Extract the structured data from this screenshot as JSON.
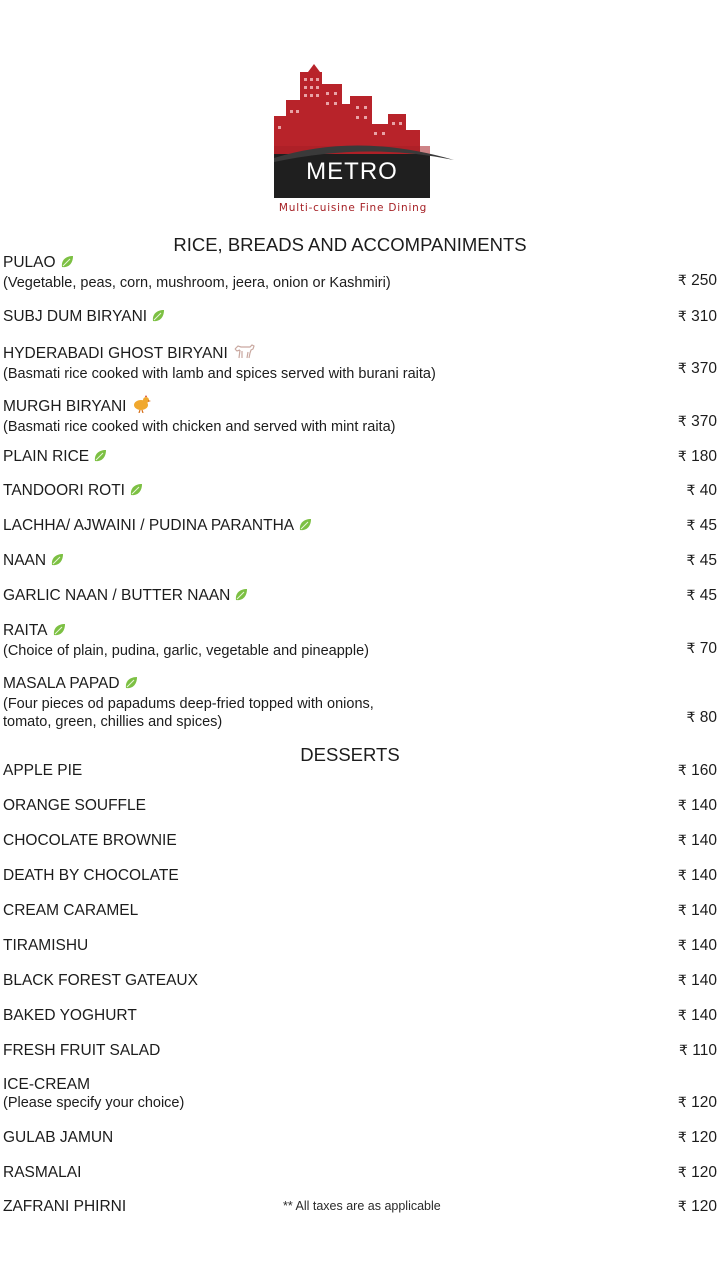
{
  "brand": {
    "name": "METRO",
    "tagline": "Multi-cuisine Fine Dining",
    "colors": {
      "red": "#b8232a",
      "black": "#1f1f1f"
    }
  },
  "sections": [
    {
      "title": "RICE, BREADS AND ACCOMPANIMENTS"
    },
    {
      "title": "DESSERTS"
    }
  ],
  "rice_items": [
    {
      "name": "PULAO",
      "icon": "veg-leaf-icon",
      "desc": [
        "(Vegetable, peas, corn, mushroom, jeera, onion or Kashmiri)"
      ],
      "price": "250"
    },
    {
      "name": "SUBJ DUM BIRYANI",
      "icon": "veg-leaf-icon",
      "desc": [],
      "price": "310"
    },
    {
      "name": "HYDERABADI GHOST BIRYANI",
      "icon": "goat-icon",
      "desc": [
        "(Basmati rice cooked with lamb and spices served with burani raita)"
      ],
      "price": "370"
    },
    {
      "name": "MURGH BIRYANI",
      "icon": "chicken-icon",
      "desc": [
        "(Basmati rice cooked with chicken and served with mint raita)"
      ],
      "price": "370"
    },
    {
      "name": "PLAIN RICE",
      "icon": "veg-leaf-icon",
      "desc": [],
      "price": "180"
    },
    {
      "name": "TANDOORI ROTI",
      "icon": "veg-leaf-icon",
      "desc": [],
      "price": "40"
    },
    {
      "name": "LACHHA/ AJWAINI / PUDINA PARANTHA",
      "icon": "veg-leaf-icon",
      "desc": [],
      "price": "45"
    },
    {
      "name": "NAAN",
      "icon": "veg-leaf-icon",
      "desc": [],
      "price": "45"
    },
    {
      "name": "GARLIC NAAN / BUTTER NAAN",
      "icon": "veg-leaf-icon",
      "desc": [],
      "price": "45"
    },
    {
      "name": "RAITA",
      "icon": "veg-leaf-icon",
      "desc": [
        "(Choice of plain, pudina, garlic, vegetable and pineapple)"
      ],
      "price": "70"
    },
    {
      "name": "MASALA PAPAD",
      "icon": "veg-leaf-icon",
      "desc": [
        "(Four pieces od papadums deep-fried topped with onions,",
        "tomato, green, chillies and spices)"
      ],
      "price": "80"
    }
  ],
  "dessert_items": [
    {
      "name": "APPLE PIE",
      "desc": [],
      "price": "160"
    },
    {
      "name": "ORANGE SOUFFLE",
      "desc": [],
      "price": "140"
    },
    {
      "name": "CHOCOLATE BROWNIE",
      "desc": [],
      "price": "140"
    },
    {
      "name": "DEATH BY CHOCOLATE",
      "desc": [],
      "price": "140"
    },
    {
      "name": "CREAM CARAMEL",
      "desc": [],
      "price": "140"
    },
    {
      "name": "TIRAMISHU",
      "desc": [],
      "price": "140"
    },
    {
      "name": "BLACK FOREST GATEAUX",
      "desc": [],
      "price": "140"
    },
    {
      "name": "BAKED YOGHURT",
      "desc": [],
      "price": "140"
    },
    {
      "name": "FRESH FRUIT SALAD",
      "desc": [],
      "price": "110"
    },
    {
      "name": "ICE-CREAM",
      "desc": [
        "(Please specify your choice)"
      ],
      "price": "120"
    },
    {
      "name": "GULAB JAMUN",
      "desc": [],
      "price": "120"
    },
    {
      "name": "RASMALAI",
      "desc": [],
      "price": "120"
    },
    {
      "name": "ZAFRANI PHIRNI",
      "desc": [],
      "price": "120"
    }
  ],
  "currency_symbol": "₹",
  "note": "** All taxes are as applicable"
}
